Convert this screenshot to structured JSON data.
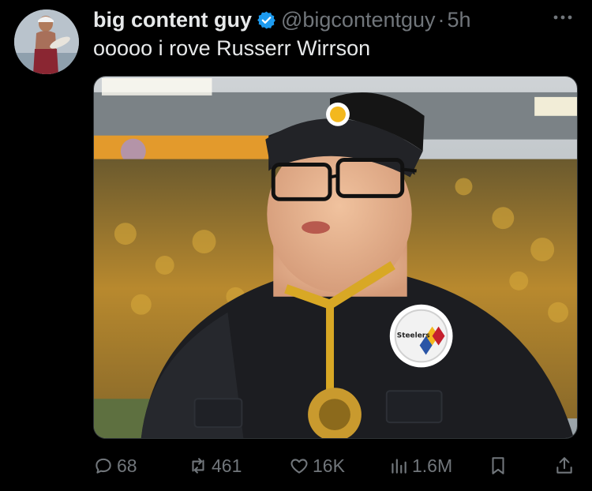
{
  "author": {
    "display_name": "big content guy",
    "handle": "@bigcontentguy",
    "separator": "·",
    "time": "5h"
  },
  "tweet": {
    "text": "ooooo i rove Russerr Wirrson"
  },
  "media": {
    "patch_text": "Steelers"
  },
  "actions": {
    "replies": "68",
    "retweets": "461",
    "likes": "16K",
    "views": "1.6M"
  },
  "colors": {
    "background": "#000000",
    "primary_text": "#e7e9ea",
    "secondary_text": "#71767b",
    "verified_blue": "#1d9bf0"
  },
  "icons": [
    "verified-badge-icon",
    "more-options-icon",
    "reply-icon",
    "retweet-icon",
    "like-icon",
    "views-icon",
    "bookmark-icon",
    "share-icon"
  ]
}
